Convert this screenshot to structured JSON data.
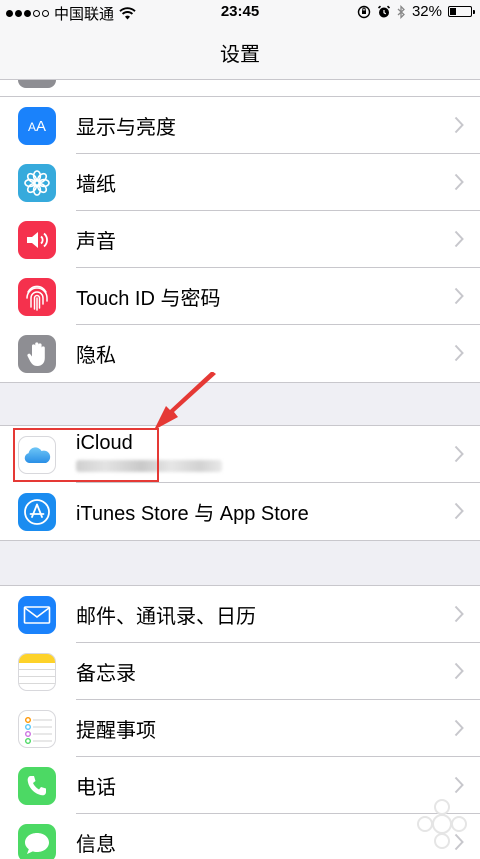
{
  "status_bar": {
    "carrier": "中国联通",
    "time": "23:45",
    "battery": "32%",
    "battery_level": 0.32,
    "icons": [
      "signal-icon",
      "wifi-icon",
      "rotation-lock-icon",
      "alarm-icon",
      "bluetooth-icon",
      "battery-icon"
    ]
  },
  "nav": {
    "title": "设置"
  },
  "groups": [
    {
      "items": [
        {
          "label": "显示与亮度",
          "icon": "display-brightness-icon",
          "color": "#1a82fb"
        },
        {
          "label": "墙纸",
          "icon": "wallpaper-flower-icon",
          "color": "#36aadc"
        },
        {
          "label": "声音",
          "icon": "speaker-icon",
          "color": "#f5314d"
        },
        {
          "label": "Touch ID 与密码",
          "icon": "fingerprint-icon",
          "color": "#f5314d"
        },
        {
          "label": "隐私",
          "icon": "hand-icon",
          "color": "#8e8e93"
        }
      ]
    },
    {
      "items": [
        {
          "label": "iCloud",
          "icon": "icloud-icon",
          "color": "#ffffff"
        },
        {
          "label": "iTunes Store 与 App Store",
          "icon": "app-store-icon",
          "color": "#1a8cf0"
        }
      ]
    },
    {
      "items": [
        {
          "label": "邮件、通讯录、日历",
          "icon": "mail-icon",
          "color": "#1a82fb"
        },
        {
          "label": "备忘录",
          "icon": "notes-icon",
          "color": "#ffffff"
        },
        {
          "label": "提醒事项",
          "icon": "reminders-icon",
          "color": "#ffffff"
        },
        {
          "label": "电话",
          "icon": "phone-icon",
          "color": "#4cd964"
        },
        {
          "label": "信息",
          "icon": "messages-icon",
          "color": "#4cd964"
        }
      ]
    }
  ],
  "annotation": {
    "highlight_color": "#e53935"
  }
}
